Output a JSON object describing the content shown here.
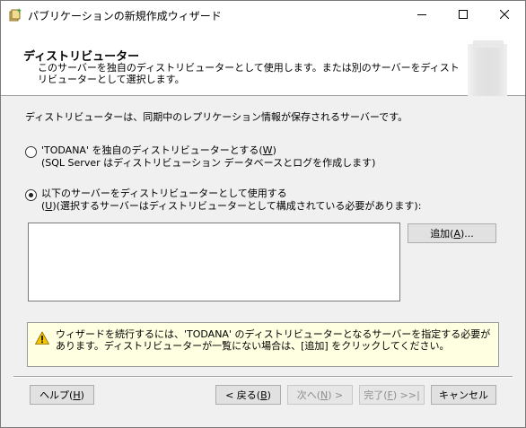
{
  "window": {
    "title": "パブリケーションの新規作成ウィザード",
    "app_icon": "wizard-app-icon",
    "controls": {
      "minimize": "minimize-icon",
      "maximize": "maximize-icon",
      "close": "close-icon"
    }
  },
  "header": {
    "title": "ディストリビューター",
    "description": "このサーバーを独自のディストリビューターとして使用します。または別のサーバーをディストリビューターとして選択します。"
  },
  "body": {
    "intro": "ディストリビューターは、同期中のレプリケーション情報が保存されるサーバーです。",
    "option1": {
      "label_prefix": "'TODANA' を独自のディストリビューターとする(",
      "label_key": "W",
      "label_suffix": ")",
      "sub": "(SQL Server はディストリビューション データベースとログを作成します)",
      "checked": false
    },
    "option2": {
      "label": "以下のサーバーをディストリビューターとして使用する",
      "sub_prefix": "(",
      "sub_key": "U",
      "sub_suffix": ")(選択するサーバーはディストリビューターとして構成されている必要があります):",
      "checked": true
    },
    "add_prefix": "追加(",
    "add_key": "A",
    "add_suffix": ")...",
    "warning": "ウィザードを続行するには、'TODANA' のディストリビューターとなるサーバーを指定する必要があります。ディストリビューターが一覧にない場合は、[追加] をクリックしてください。"
  },
  "footer": {
    "help_prefix": "ヘルプ(",
    "help_key": "H",
    "help_suffix": ")",
    "back_prefix": "< 戻る(",
    "back_key": "B",
    "back_suffix": ")",
    "next_prefix": "次へ(",
    "next_key": "N",
    "next_suffix": ") >",
    "finish_prefix": "完了(",
    "finish_key": "F",
    "finish_suffix": ") >>|",
    "cancel": "キャンセル"
  },
  "colors": {
    "warning_bg": "#ffffe1",
    "warning_icon": "#f5c400",
    "button_bg": "#e1e1e1",
    "disabled_text": "#8d8d8d"
  }
}
